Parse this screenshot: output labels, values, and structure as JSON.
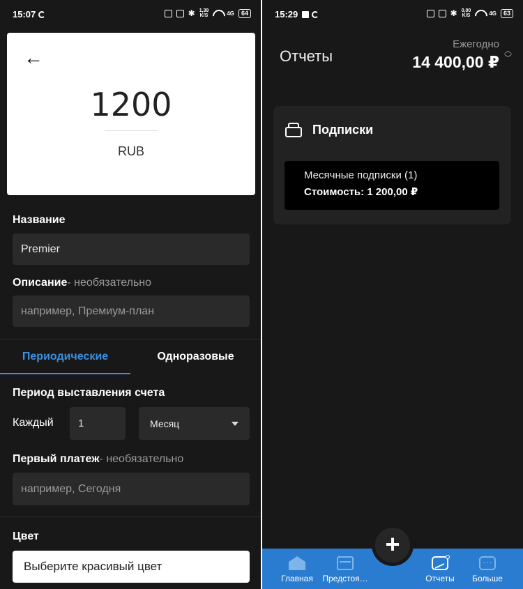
{
  "left": {
    "status": {
      "time": "15:07",
      "speed": "1,38",
      "speed_unit": "K/S",
      "network": "4G",
      "battery": "64"
    },
    "amount": {
      "value": "1200",
      "currency": "RUB"
    },
    "name_label": "Название",
    "name_value": "Premier",
    "description_label": "Описание",
    "description_optional": "- необязательно",
    "description_placeholder": "например, Премиум-план",
    "tabs": [
      {
        "label": "Периодические"
      },
      {
        "label": "Одноразовые"
      }
    ],
    "billing_period_label": "Период выставления счета",
    "every_label": "Каждый",
    "every_value": "1",
    "period_select": "Месяц",
    "first_payment_label": "Первый платеж",
    "first_payment_optional": "- необязательно",
    "first_payment_placeholder": "например, Сегодня",
    "color_label": "Цвет",
    "color_button": "Выберите красивый цвет"
  },
  "right": {
    "status": {
      "time": "15:29",
      "speed": "0,00",
      "speed_unit": "K/S",
      "network": "4G",
      "battery": "63"
    },
    "title": "Отчеты",
    "period": "Ежегодно",
    "total": "14 400,00 ₽",
    "subscriptions_title": "Подписки",
    "subscription_item": {
      "line1": "Месячные подписки (1)",
      "line2": "Стоимость: 1 200,00 ₽"
    },
    "fab_label": "+",
    "nav": [
      {
        "label": "Главная",
        "icon": "home-icon"
      },
      {
        "label": "Предстоя…",
        "icon": "card-icon"
      },
      {
        "label": "Отчеты",
        "icon": "chart-icon"
      },
      {
        "label": "Больше",
        "icon": "more-icon"
      }
    ]
  },
  "colors": {
    "accent": "#3d8fe0",
    "navbar": "#2a7cd0",
    "background": "#181818",
    "field": "#2a2a2a"
  }
}
